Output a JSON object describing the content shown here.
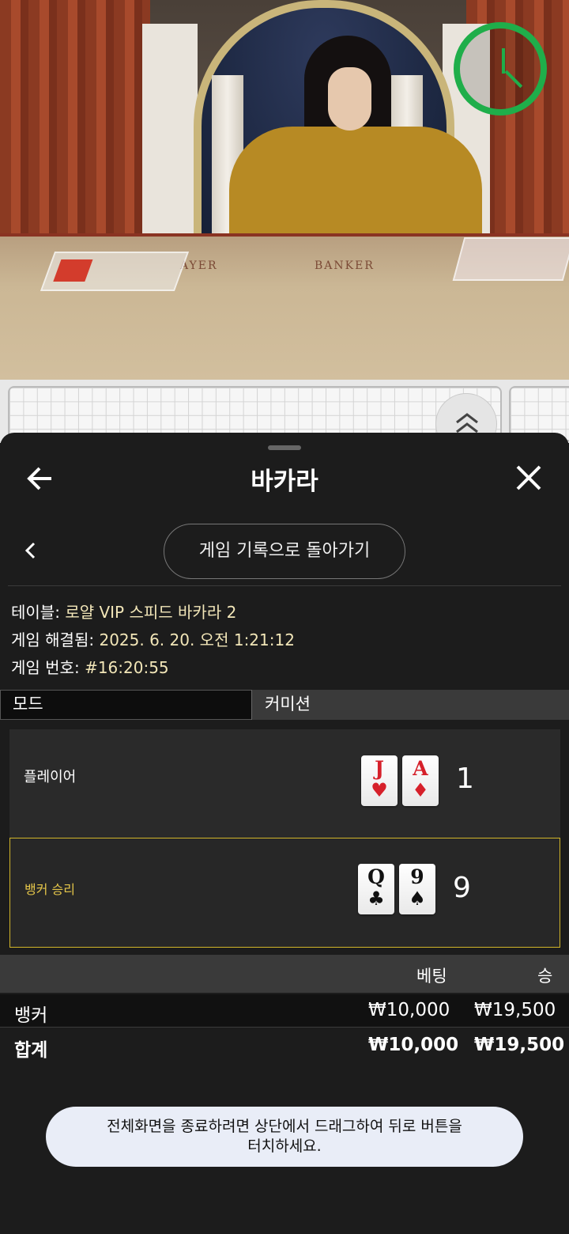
{
  "video": {
    "table_labels": [
      "AYER",
      "BANKER"
    ],
    "accent_timer_color": "#1fae4a"
  },
  "header": {
    "title": "바카라",
    "back_icon": "arrow-left-icon",
    "close_icon": "close-icon"
  },
  "history_nav": {
    "back_chevron": "chevron-left-icon",
    "button_label": "게임 기록으로 돌아가기"
  },
  "game_info": {
    "table_label": "테이블:",
    "table_value": "로얄 VIP 스피드 바카라 2",
    "resolved_label": "게임 해결됨:",
    "resolved_value": "2025. 6. 20. 오전 1:21:12",
    "number_label": "게임 번호:",
    "number_value": "#16:20:55"
  },
  "tabs": {
    "mode": "모드",
    "commission": "커미션"
  },
  "result": {
    "player": {
      "label": "플레이어",
      "cards": [
        {
          "rank": "J",
          "suit": "♥",
          "color": "red"
        },
        {
          "rank": "A",
          "suit": "♦",
          "color": "red"
        }
      ],
      "score": "1"
    },
    "banker": {
      "label": "뱅커 승리",
      "label_color": "#e5c64a",
      "cards": [
        {
          "rank": "Q",
          "suit": "♣",
          "color": "black"
        },
        {
          "rank": "9",
          "suit": "♠",
          "color": "black"
        }
      ],
      "score": "9"
    }
  },
  "bets": {
    "col_bet": "베팅",
    "col_win": "승",
    "rows": [
      {
        "name": "뱅커",
        "bet": "₩10,000",
        "win": "₩19,500"
      }
    ],
    "total": {
      "name": "합계",
      "bet": "₩10,000",
      "win": "₩19,500"
    }
  },
  "toast": {
    "line1": "전체화면을 종료하려면 상단에서 드래그하여 뒤로 버튼을",
    "line2": "터치하세요."
  }
}
